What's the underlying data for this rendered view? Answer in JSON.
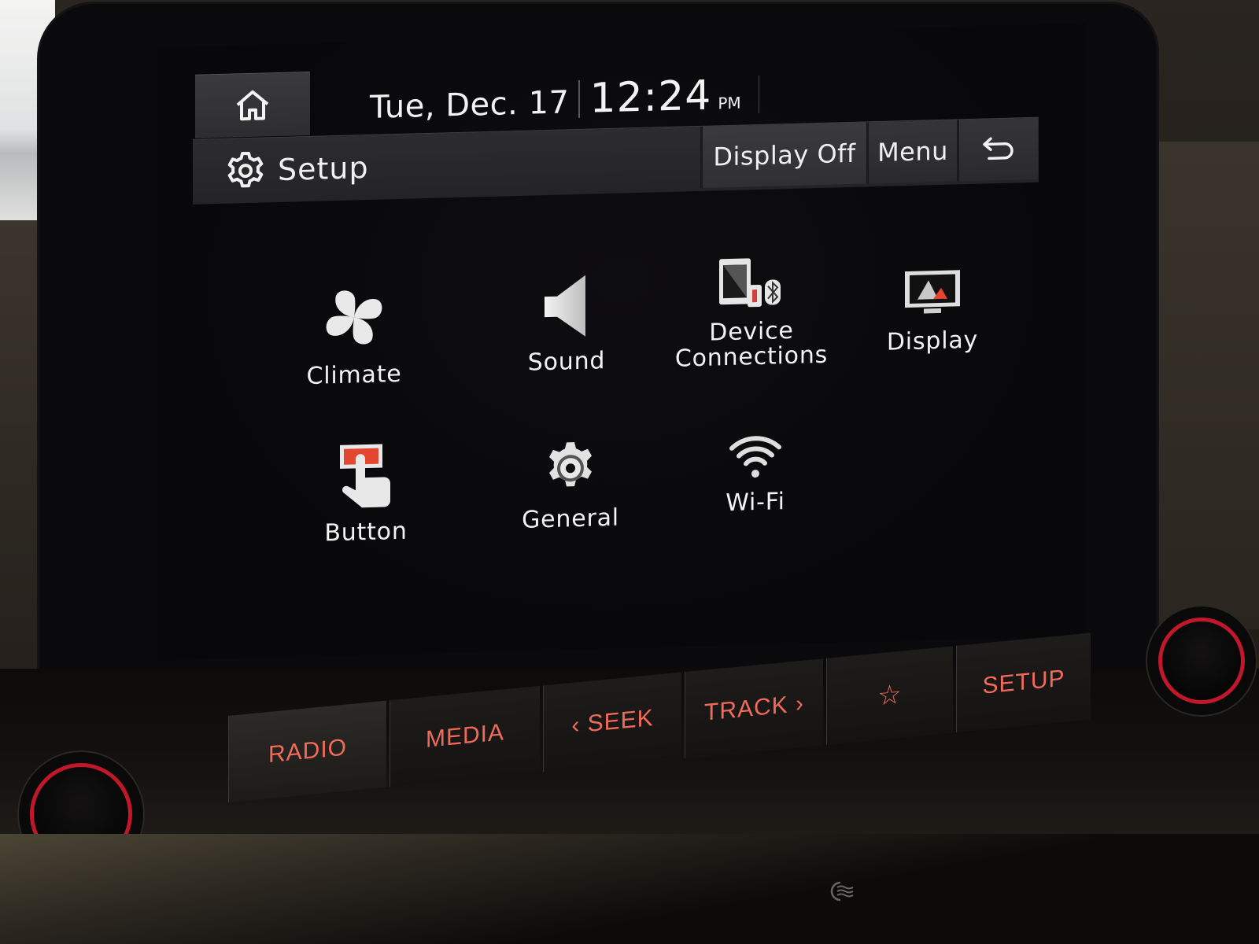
{
  "status_bar": {
    "home_label": "Home",
    "date": "Tue, Dec. 17",
    "time": "12:24",
    "ampm": "PM"
  },
  "title_bar": {
    "title": "Setup",
    "title_icon": "gear-icon",
    "buttons": {
      "display_off": "Display Off",
      "menu": "Menu",
      "back_icon": "back-arrow-icon"
    }
  },
  "settings": [
    {
      "label": "Climate",
      "icon": "fan-icon"
    },
    {
      "label": "Sound",
      "icon": "speaker-icon"
    },
    {
      "label": "Device\nConnections",
      "icon": "device-connections-icon"
    },
    {
      "label": "Display",
      "icon": "monitor-icon"
    },
    {
      "label": "Button",
      "icon": "button-press-icon"
    },
    {
      "label": "General",
      "icon": "general-gear-icon"
    },
    {
      "label": "Wi-Fi",
      "icon": "wifi-icon"
    }
  ],
  "hardware_buttons": {
    "radio": "RADIO",
    "media": "MEDIA",
    "seek": "‹ SEEK",
    "track": "TRACK ›",
    "favorite": "☆",
    "setup": "SETUP"
  },
  "colors": {
    "screen_bg": "#08080a",
    "bar_bg": "#2c2c2f",
    "text": "#f2f2f2",
    "hw_accent": "#f26a5a",
    "knob_ring": "#c0172a",
    "button_icon_red": "#e8432e"
  }
}
